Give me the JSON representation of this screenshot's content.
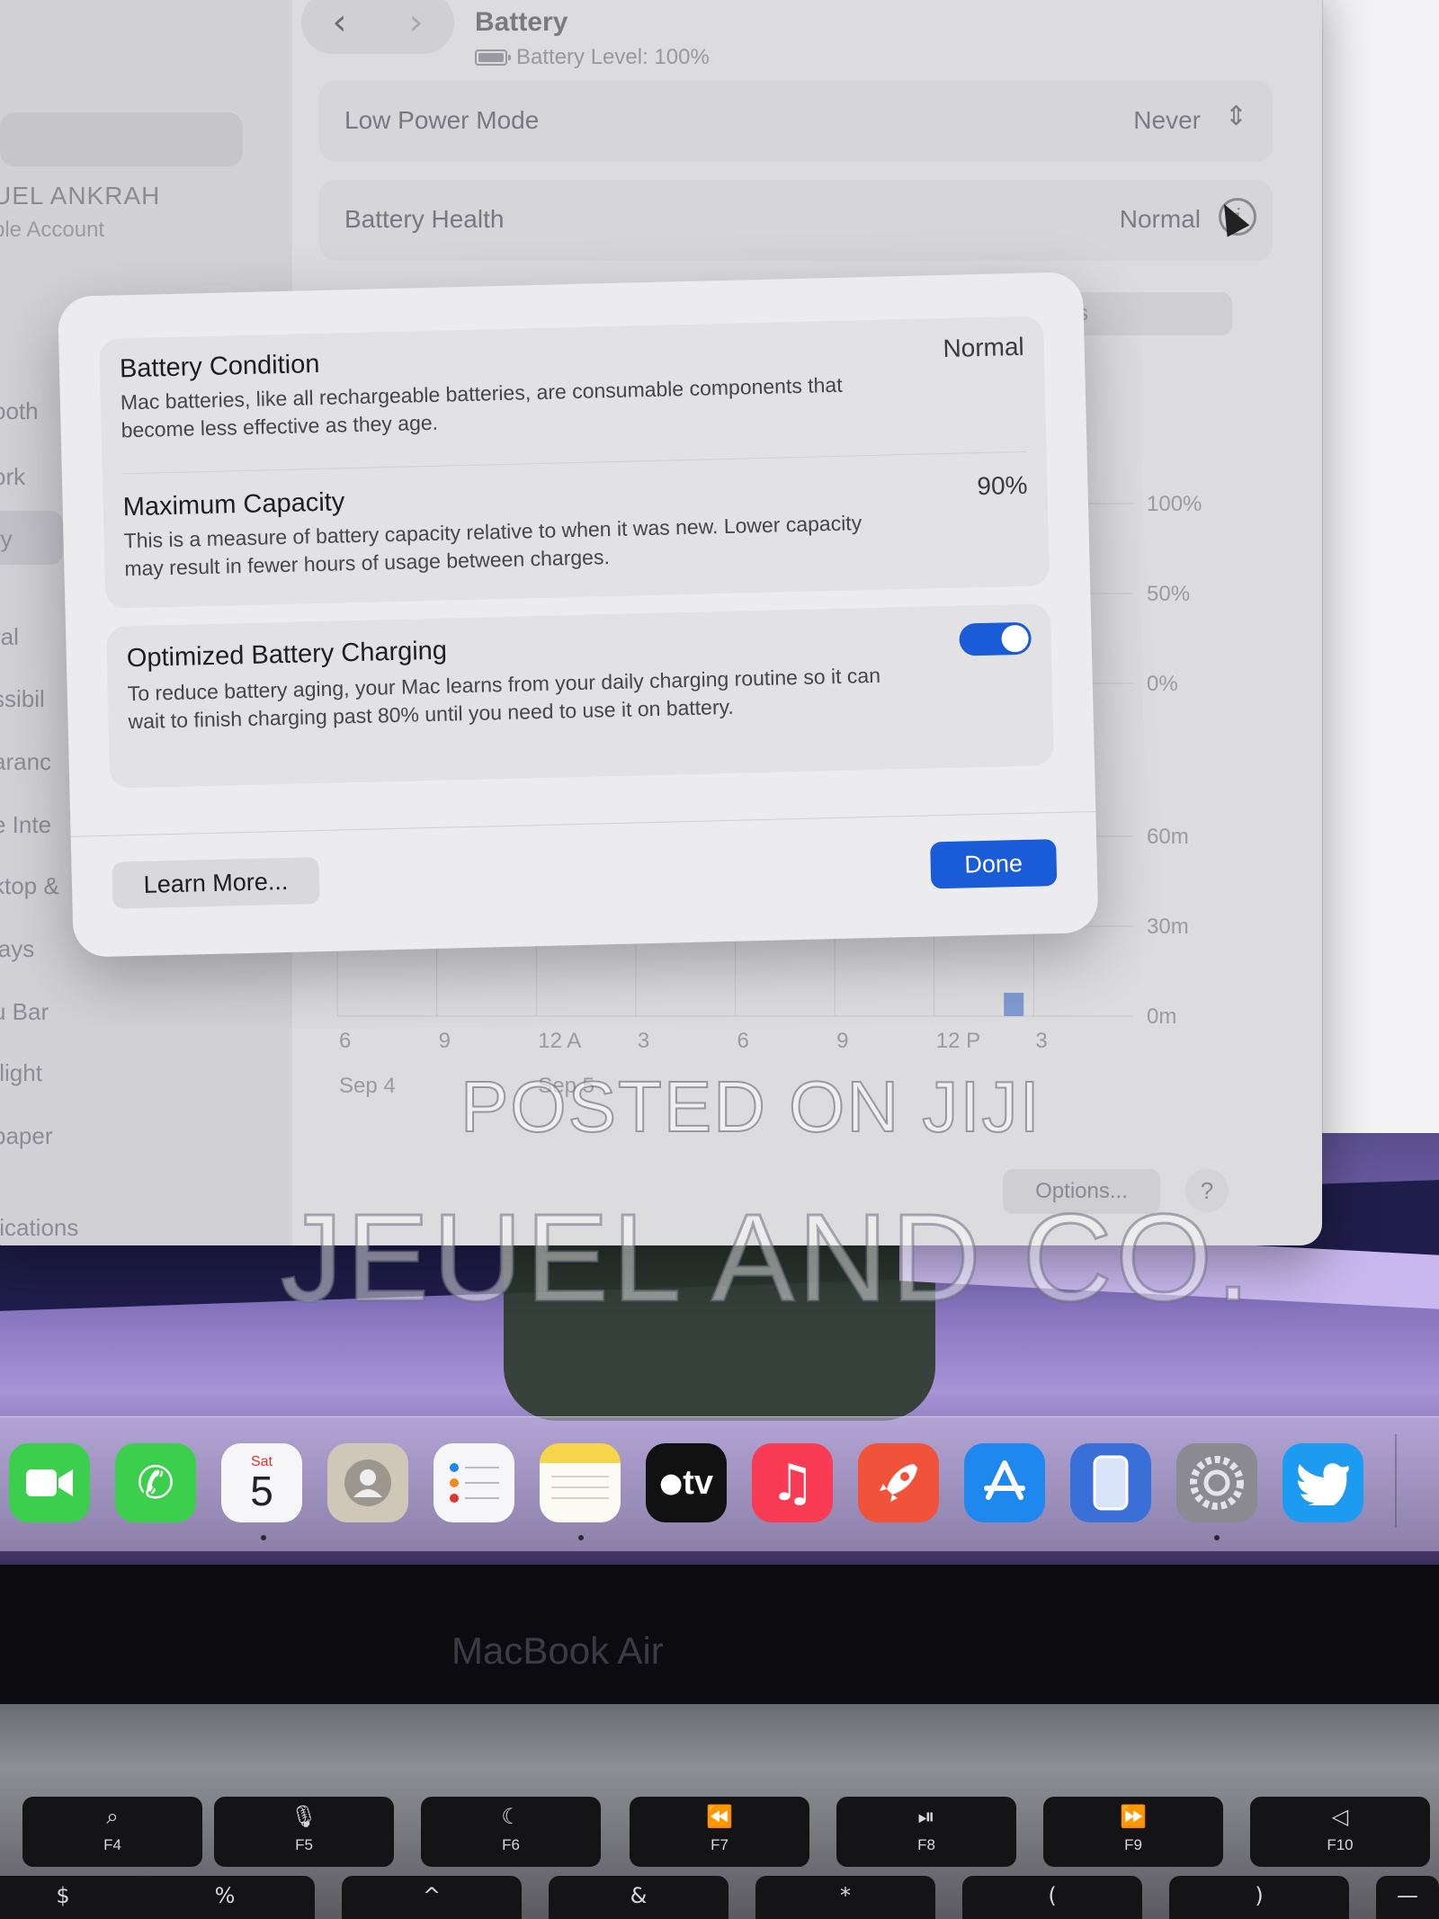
{
  "window": {
    "title": "Battery",
    "subtitle": "Battery Level: 100%",
    "back_glyph": "‹",
    "forward_glyph": "›"
  },
  "sidebar": {
    "user_name": "UEL ANKRAH",
    "user_sub": "ple Account",
    "items": [
      "ooth",
      "ork",
      "ry",
      "ral",
      "ssibil",
      "aranc",
      "e Inte",
      "ktop &",
      "lays",
      "u Bar",
      "tlight",
      "paper",
      "fications"
    ]
  },
  "settings": {
    "low_power_label": "Low Power Mode",
    "low_power_value": "Never",
    "health_label": "Battery Health",
    "health_value": "Normal",
    "segment_fragment": "ys"
  },
  "chart_data": [
    {
      "type": "bar",
      "y_ticks": [
        "100%",
        "50%",
        "0%"
      ],
      "ylim": [
        0,
        100
      ]
    },
    {
      "type": "bar",
      "y_ticks": [
        "60m",
        "30m",
        "0m"
      ],
      "x_ticks": [
        "6",
        "9",
        "12 A",
        "3",
        "6",
        "9",
        "12 P",
        "3"
      ],
      "date_labels": [
        "Sep 4",
        "Sep 5"
      ],
      "ylim": [
        0,
        60
      ]
    }
  ],
  "modal": {
    "condition_title": "Battery Condition",
    "condition_value": "Normal",
    "condition_desc": "Mac batteries, like all rechargeable batteries, are consumable components that become less effective as they age.",
    "capacity_title": "Maximum Capacity",
    "capacity_value": "90%",
    "capacity_desc": "This is a measure of battery capacity relative to when it was new. Lower capacity may result in fewer hours of usage between charges.",
    "optimized_title": "Optimized Battery Charging",
    "optimized_desc": "To reduce battery aging, your Mac learns from your daily charging routine so it can wait to finish charging past 80% until you need to use it on battery.",
    "optimized_enabled": true,
    "learn_more": "Learn More...",
    "done": "Done"
  },
  "footer": {
    "options": "Options...",
    "help": "?"
  },
  "watermark": {
    "line1": "POSTED ON JIJI",
    "line2": "JEUEL AND CO."
  },
  "dock": {
    "calendar_day": "Sat",
    "calendar_date": "5",
    "tv_label": "tv",
    "apps": [
      "facetime-icon",
      "phone-icon",
      "calendar-icon",
      "contacts-icon",
      "reminders-icon",
      "notes-icon",
      "apple-tv-icon",
      "music-icon",
      "rocket-icon",
      "app-store-icon",
      "iphone-mirroring-icon",
      "system-settings-icon",
      "twitter-icon"
    ],
    "colors": {
      "facetime": "#3ccf4e",
      "phone": "#3ccf4e",
      "music": "#fa3b54",
      "rocket": "#f0523a",
      "appstore": "#1e88ef",
      "twitter": "#1d9bf0",
      "accent": "#1a5bd8"
    }
  },
  "laptop": {
    "model_label": "MacBook Air",
    "fkeys": [
      {
        "icon": "⌕",
        "label": "F4"
      },
      {
        "icon": "🎙",
        "label": "F5"
      },
      {
        "icon": "☾",
        "label": "F6"
      },
      {
        "icon": "⏪",
        "label": "F7"
      },
      {
        "icon": "⏯",
        "label": "F8"
      },
      {
        "icon": "⏩",
        "label": "F9"
      },
      {
        "icon": "◁",
        "label": "F10"
      }
    ],
    "number_row": [
      "$",
      "%",
      "^",
      "&",
      "*",
      "(",
      ")",
      "—"
    ]
  }
}
